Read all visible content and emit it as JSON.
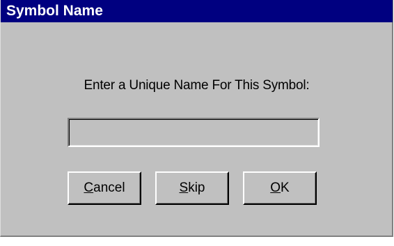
{
  "window": {
    "title": "Symbol Name"
  },
  "form": {
    "prompt": "Enter a Unique Name For This Symbol:",
    "name_value": ""
  },
  "buttons": {
    "cancel": {
      "accel": "C",
      "rest": "ancel"
    },
    "skip": {
      "accel": "S",
      "rest": "kip"
    },
    "ok": {
      "accel": "O",
      "rest": "K"
    }
  }
}
